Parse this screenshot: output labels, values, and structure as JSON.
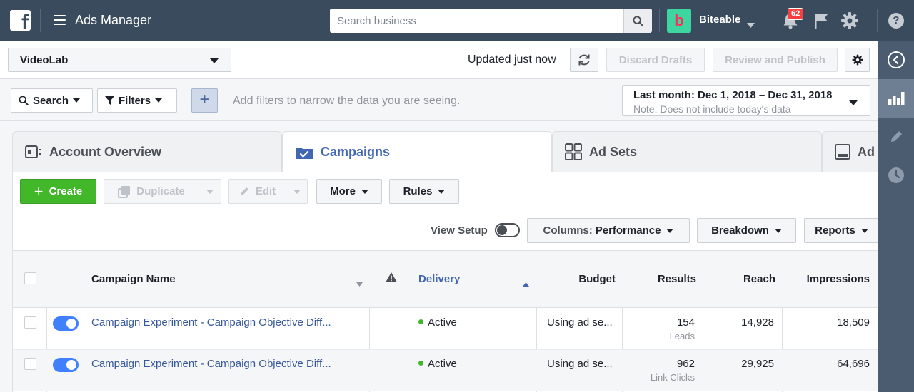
{
  "topbar": {
    "logo_letter": "f",
    "app_title": "Ads Manager",
    "search_placeholder": "Search business",
    "business_icon_letter": "b",
    "business_name": "Biteable",
    "notification_count": "62",
    "help_label": "?",
    "colors": {
      "bg": "#3b4b5e",
      "business_icon": "#3dd6a0",
      "badge": "#fa3e3e"
    }
  },
  "account_bar": {
    "account_name": "VideoLab",
    "updated_text": "Updated just now",
    "discard_label": "Discard Drafts",
    "review_label": "Review and Publish"
  },
  "filter_bar": {
    "search_label": "Search",
    "filters_label": "Filters",
    "plus_label": "+",
    "hint": "Add filters to narrow the data you are seeing.",
    "date_range": "Last month: Dec 1, 2018 – Dec 31, 2018",
    "date_note": "Note: Does not include today's data"
  },
  "tabs": [
    {
      "label": "Account Overview",
      "icon": "account-overview-icon"
    },
    {
      "label": "Campaigns",
      "icon": "campaigns-icon",
      "active": true
    },
    {
      "label": "Ad Sets",
      "icon": "ad-sets-icon"
    },
    {
      "label": "Ad",
      "icon": "ads-icon"
    }
  ],
  "toolbar": {
    "create_label": "Create",
    "duplicate_label": "Duplicate",
    "edit_label": "Edit",
    "more_label": "More",
    "rules_label": "Rules",
    "view_setup_label": "View Setup",
    "columns_prefix": "Columns:",
    "columns_value": "Performance",
    "breakdown_label": "Breakdown",
    "reports_label": "Reports"
  },
  "table": {
    "headers": {
      "name": "Campaign Name",
      "delivery": "Delivery",
      "budget": "Budget",
      "results": "Results",
      "reach": "Reach",
      "impressions": "Impressions"
    },
    "rows": [
      {
        "name": "Campaign Experiment - Campaign Objective Diff...",
        "delivery": "Active",
        "budget": "Using ad se...",
        "results": "154",
        "results_type": "Leads",
        "reach": "14,928",
        "impressions": "18,509"
      },
      {
        "name": "Campaign Experiment - Campaign Objective Diff...",
        "delivery": "Active",
        "budget": "Using ad se...",
        "results": "962",
        "results_type": "Link Clicks",
        "reach": "29,925",
        "impressions": "64,696"
      }
    ]
  }
}
